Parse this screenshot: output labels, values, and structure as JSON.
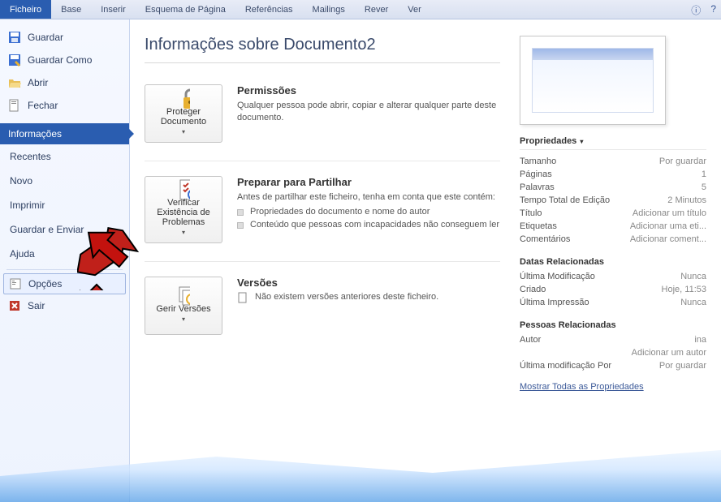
{
  "ribbon": {
    "tabs": [
      "Ficheiro",
      "Base",
      "Inserir",
      "Esquema de Página",
      "Referências",
      "Mailings",
      "Rever",
      "Ver"
    ],
    "active": 0
  },
  "sidebar": {
    "top": [
      {
        "icon": "save",
        "label": "Guardar"
      },
      {
        "icon": "save-as",
        "label": "Guardar Como"
      },
      {
        "icon": "open",
        "label": "Abrir"
      },
      {
        "icon": "close",
        "label": "Fechar"
      }
    ],
    "mid": [
      {
        "label": "Informações",
        "selected": true
      },
      {
        "label": "Recentes"
      },
      {
        "label": "Novo"
      },
      {
        "label": "Imprimir"
      },
      {
        "label": "Guardar e Enviar"
      },
      {
        "label": "Ajuda"
      }
    ],
    "bottom": [
      {
        "icon": "options",
        "label": "Opções",
        "framed": true
      },
      {
        "icon": "exit",
        "label": "Sair"
      }
    ]
  },
  "page": {
    "title": "Informações sobre Documento2",
    "sections": [
      {
        "btn": {
          "label": "Proteger Documento",
          "dd": true
        },
        "heading": "Permissões",
        "text": "Qualquer pessoa pode abrir, copiar e alterar qualquer parte deste documento."
      },
      {
        "btn": {
          "label": "Verificar Existência de Problemas",
          "dd": true
        },
        "heading": "Preparar para Partilhar",
        "text": "Antes de partilhar este ficheiro, tenha em conta que este contém:",
        "bullets": [
          "Propriedades do documento e nome do autor",
          "Conteúdo que pessoas com incapacidades não conseguem ler"
        ]
      },
      {
        "btn": {
          "label": "Gerir Versões",
          "dd": true
        },
        "heading": "Versões",
        "textIcon": true,
        "text": "Não existem versões anteriores deste ficheiro."
      }
    ]
  },
  "props": {
    "heading": "Propriedades",
    "rows": [
      {
        "k": "Tamanho",
        "v": "Por guardar"
      },
      {
        "k": "Páginas",
        "v": "1"
      },
      {
        "k": "Palavras",
        "v": "5"
      },
      {
        "k": "Tempo Total de Edição",
        "v": "2 Minutos"
      },
      {
        "k": "Título",
        "v": "Adicionar um título"
      },
      {
        "k": "Etiquetas",
        "v": "Adicionar uma eti..."
      },
      {
        "k": "Comentários",
        "v": "Adicionar coment..."
      }
    ],
    "dates_h": "Datas Relacionadas",
    "dates": [
      {
        "k": "Última Modificação",
        "v": "Nunca"
      },
      {
        "k": "Criado",
        "v": "Hoje, 11:53"
      },
      {
        "k": "Última Impressão",
        "v": "Nunca"
      }
    ],
    "people_h": "Pessoas Relacionadas",
    "people": [
      {
        "k": "Autor",
        "v": "ina"
      },
      {
        "k": "",
        "v": "Adicionar um autor"
      },
      {
        "k": "Última modificação Por",
        "v": "Por guardar"
      }
    ],
    "show_all": "Mostrar Todas as Propriedades"
  }
}
